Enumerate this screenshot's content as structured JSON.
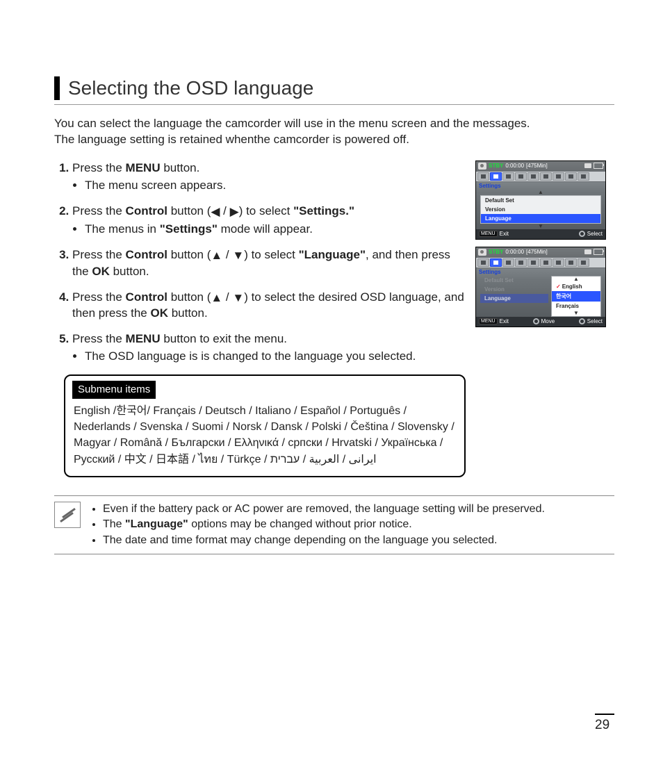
{
  "heading": "Selecting the OSD language",
  "intro_l1": "You can select the language the camcorder will use in the menu screen and the messages.",
  "intro_l2": "The language setting is retained whenthe camcorder is powered off.",
  "steps": {
    "s1_a": "Press the ",
    "s1_b": "MENU",
    "s1_c": " button.",
    "s1_sub": "The menu screen appears.",
    "s2_a": "Press the ",
    "s2_b": "Control",
    "s2_c": " button (",
    "s2_d": ") to select ",
    "s2_e": "\"Settings.\"",
    "s2_sub_a": "The menus in ",
    "s2_sub_b": "\"Settings\"",
    "s2_sub_c": " mode will appear.",
    "s3_a": "Press the ",
    "s3_b": "Control",
    "s3_c": " button (",
    "s3_d": ") to select ",
    "s3_e": "\"Language\"",
    "s3_f": ", and then press the ",
    "s3_g": "OK",
    "s3_h": " button.",
    "s4_a": "Press the ",
    "s4_b": "Control",
    "s4_c": " button (",
    "s4_d": ") to select the desired OSD language, and then press the ",
    "s4_e": "OK",
    "s4_f": " button.",
    "s5_a": "Press the ",
    "s5_b": "MENU",
    "s5_c": " button to exit the menu.",
    "s5_sub": "The OSD language is is changed to the language you selected."
  },
  "submenu": {
    "title": "Submenu items",
    "body": "English /한국어/ Français / Deutsch / Italiano / Español / Português / Nederlands / Svenska / Suomi / Norsk / Dansk / Polski / Čeština / Slovensky / Magyar / Română / Български / Ελληνικά / српски / Hrvatski / Українська / Русский /  中文 / 日本語 / ไทย / Türkçe / ايرانى / العربية / עברית"
  },
  "notes": {
    "n1": "Even if the battery pack or AC power are removed, the language setting will be preserved.",
    "n2_a": "The ",
    "n2_b": "\"Language\"",
    "n2_c": " options may be changed without prior notice.",
    "n3": "The date and time format may change depending on the language you selected."
  },
  "screens": {
    "s1": {
      "stby": "STBY",
      "tc": "0:00:00",
      "rem": "[475Min]",
      "settings": "Settings",
      "items": [
        "Default Set",
        "Version",
        "Language"
      ],
      "menu_label": "MENU",
      "exit": "Exit",
      "select": "Select"
    },
    "s2": {
      "stby": "STBY",
      "tc": "0:00:00",
      "rem": "[475Min]",
      "settings": "Settings",
      "left_items": [
        "Default Set",
        "Version",
        "Language"
      ],
      "opts": [
        "English",
        "한국어",
        "Français"
      ],
      "menu_label": "MENU",
      "exit": "Exit",
      "move": "Move",
      "select": "Select"
    }
  },
  "page_no": "29",
  "glyphs": {
    "left": "◀",
    "right": "▶",
    "up": "▲",
    "down": "▼",
    "slash": " / "
  }
}
